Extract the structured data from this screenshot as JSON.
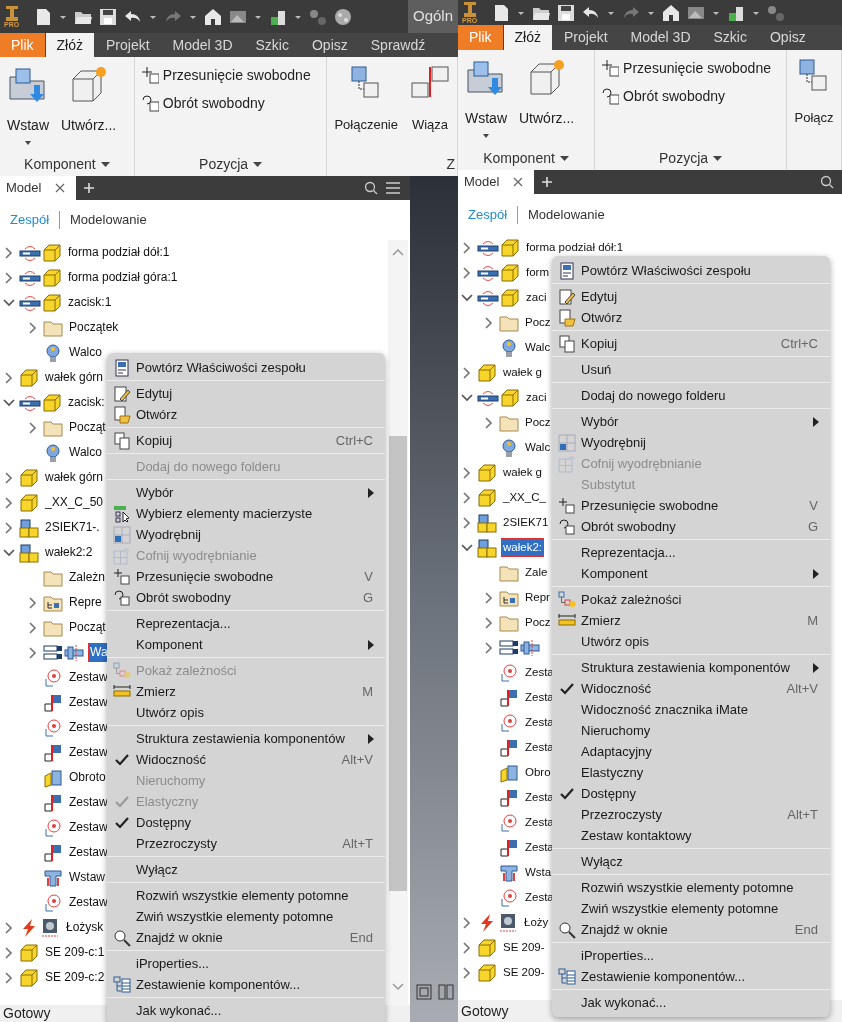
{
  "panels": [
    {
      "toolbar": {
        "edition": "PRO",
        "workspace": "Ogóln"
      },
      "tabs": [
        {
          "label": "Plik",
          "kind": "file",
          "selected": false
        },
        {
          "label": "Złóż",
          "kind": "tab",
          "selected": true
        },
        {
          "label": "Projekt",
          "kind": "tab",
          "selected": false
        },
        {
          "label": "Model 3D",
          "kind": "tab",
          "selected": false
        },
        {
          "label": "Szkic",
          "kind": "tab",
          "selected": false
        },
        {
          "label": "Opisz",
          "kind": "tab",
          "selected": false
        },
        {
          "label": "Sprawdź",
          "kind": "tab",
          "selected": false
        }
      ],
      "ribbon": [
        {
          "kind": "large",
          "title": "Komponent",
          "title_dropdown": true,
          "buttons": [
            {
              "label": "Wstaw",
              "dropdown": true
            },
            {
              "label": "Utwórz...",
              "dropdown": false
            }
          ]
        },
        {
          "kind": "small",
          "title": "Pozycja",
          "title_dropdown": true,
          "buttons": [
            {
              "label": "Przesunięcie swobodne"
            },
            {
              "label": "Obrót swobodny"
            }
          ]
        },
        {
          "kind": "large",
          "title": "Z",
          "title_dropdown": false,
          "buttons": [
            {
              "label": "Połączenie",
              "dropdown": false
            },
            {
              "label": "Wiąza",
              "dropdown": false
            }
          ]
        }
      ],
      "browser": {
        "tab": "Model",
        "subtabs": [
          {
            "label": "Zespół",
            "selected": true
          },
          {
            "label": "Modelowanie",
            "selected": false
          }
        ],
        "tree": [
          {
            "label": "forma podział dół:1",
            "kind": "linkedpart",
            "expanded": false,
            "selected": false
          },
          {
            "label": "forma podział góra:1",
            "kind": "linkedpart",
            "expanded": false,
            "selected": false
          },
          {
            "label": "zacisk:1",
            "kind": "linkedpart",
            "expanded": true,
            "selected": false,
            "children": [
              {
                "label": "Początek",
                "kind": "folder",
                "expanded": false,
                "selected": false
              },
              {
                "label": "Walco",
                "kind": "joint",
                "selected": false
              }
            ]
          },
          {
            "label": "wałek górn",
            "kind": "part",
            "expanded": false,
            "selected": false
          },
          {
            "label": "zacisk:",
            "kind": "linkedpart",
            "expanded": true,
            "selected": false,
            "children": [
              {
                "label": "Począt",
                "kind": "folder",
                "expanded": false,
                "selected": false
              },
              {
                "label": "Walco",
                "kind": "joint",
                "selected": false
              }
            ]
          },
          {
            "label": "wałek górn",
            "kind": "part",
            "expanded": false,
            "selected": false
          },
          {
            "label": "_XX_C_50",
            "kind": "part",
            "expanded": false,
            "selected": false
          },
          {
            "label": "2SIEK71-.",
            "kind": "assembly",
            "expanded": false,
            "selected": false
          },
          {
            "label": "wałek2:2",
            "kind": "assembly",
            "expanded": true,
            "selected": false,
            "children": [
              {
                "label": "Zależn",
                "kind": "folder",
                "selected": false
              },
              {
                "label": "Repre",
                "kind": "views",
                "expanded": false,
                "selected": false
              },
              {
                "label": "Począt",
                "kind": "folder",
                "expanded": false,
                "selected": false
              },
              {
                "label": "Wa",
                "kind": "shaft",
                "expanded": false,
                "selected": true
              },
              {
                "label": "Zestaw",
                "kind": "target",
                "selected": false
              },
              {
                "label": "Zestaw",
                "kind": "flush",
                "selected": false
              },
              {
                "label": "Zestaw",
                "kind": "target",
                "selected": false
              },
              {
                "label": "Zestaw",
                "kind": "flush",
                "selected": false
              },
              {
                "label": "Obroto",
                "kind": "hinge",
                "selected": false
              },
              {
                "label": "Zestaw",
                "kind": "flush",
                "selected": false
              },
              {
                "label": "Zestaw",
                "kind": "target",
                "selected": false
              },
              {
                "label": "Zestaw",
                "kind": "flush",
                "selected": false
              },
              {
                "label": "Wstaw",
                "kind": "insert",
                "selected": false
              },
              {
                "label": "Zestaw",
                "kind": "target",
                "selected": false
              }
            ]
          },
          {
            "label": "Łożysk",
            "kind": "bearing",
            "expanded": false,
            "selected": false
          },
          {
            "label": "SE 209-c:1",
            "kind": "part",
            "expanded": false,
            "selected": false
          },
          {
            "label": "SE 209-c:2",
            "kind": "part",
            "expanded": false,
            "selected": false
          }
        ]
      },
      "context_menu": [
        {
          "kind": "item",
          "label": "Powtórz Właściwości zespołu",
          "disabled": false,
          "checked": false
        },
        {
          "kind": "separator"
        },
        {
          "kind": "item",
          "label": "Edytuj",
          "disabled": false,
          "checked": false
        },
        {
          "kind": "item",
          "label": "Otwórz",
          "disabled": false,
          "checked": false
        },
        {
          "kind": "separator"
        },
        {
          "kind": "item",
          "label": "Kopiuj",
          "shortcut": "Ctrl+C",
          "disabled": false,
          "checked": false
        },
        {
          "kind": "separator"
        },
        {
          "kind": "item",
          "label": "Dodaj do nowego folderu",
          "disabled": true,
          "checked": false
        },
        {
          "kind": "separator"
        },
        {
          "kind": "submenu",
          "label": "Wybór",
          "disabled": false,
          "checked": false
        },
        {
          "kind": "item",
          "label": "Wybierz elementy macierzyste",
          "disabled": false,
          "checked": false
        },
        {
          "kind": "item",
          "label": "Wyodrębnij",
          "disabled": false,
          "checked": false
        },
        {
          "kind": "item",
          "label": "Cofnij wyodrębnianie",
          "disabled": true,
          "checked": false
        },
        {
          "kind": "item",
          "label": "Przesunięcie swobodne",
          "shortcut": "V",
          "disabled": false,
          "checked": false
        },
        {
          "kind": "item",
          "label": "Obrót swobodny",
          "shortcut": "G",
          "disabled": false,
          "checked": false
        },
        {
          "kind": "separator"
        },
        {
          "kind": "item",
          "label": "Reprezentacja...",
          "disabled": false,
          "checked": false
        },
        {
          "kind": "submenu",
          "label": "Komponent",
          "disabled": false,
          "checked": false
        },
        {
          "kind": "separator"
        },
        {
          "kind": "item",
          "label": "Pokaż zależności",
          "disabled": true,
          "checked": false
        },
        {
          "kind": "item",
          "label": "Zmierz",
          "shortcut": "M",
          "disabled": false,
          "checked": false
        },
        {
          "kind": "item",
          "label": "Utwórz opis",
          "disabled": false,
          "checked": false
        },
        {
          "kind": "separator"
        },
        {
          "kind": "submenu",
          "label": "Struktura zestawienia komponentów",
          "disabled": false,
          "checked": false
        },
        {
          "kind": "item",
          "label": "Widoczność",
          "shortcut": "Alt+V",
          "disabled": false,
          "checked": true
        },
        {
          "kind": "item",
          "label": "Nieruchomy",
          "disabled": true,
          "checked": false
        },
        {
          "kind": "item",
          "label": "Elastyczny",
          "disabled": true,
          "checked": true
        },
        {
          "kind": "item",
          "label": "Dostępny",
          "disabled": false,
          "checked": true
        },
        {
          "kind": "item",
          "label": "Przezroczysty",
          "shortcut": "Alt+T",
          "disabled": false,
          "checked": false
        },
        {
          "kind": "separator"
        },
        {
          "kind": "item",
          "label": "Wyłącz",
          "disabled": false,
          "checked": false
        },
        {
          "kind": "separator"
        },
        {
          "kind": "item",
          "label": "Rozwiń wszystkie elementy potomne",
          "disabled": false,
          "checked": false
        },
        {
          "kind": "item",
          "label": "Zwiń wszystkie elementy potomne",
          "disabled": false,
          "checked": false
        },
        {
          "kind": "item",
          "label": "Znajdź w oknie",
          "shortcut": "End",
          "disabled": false,
          "checked": false
        },
        {
          "kind": "separator"
        },
        {
          "kind": "item",
          "label": "iProperties...",
          "disabled": false,
          "checked": false
        },
        {
          "kind": "item",
          "label": "Zestawienie komponentów...",
          "disabled": false,
          "checked": false
        },
        {
          "kind": "separator"
        },
        {
          "kind": "item",
          "label": "Jak wykonać...",
          "disabled": false,
          "checked": false
        }
      ],
      "status_bar": "Gotowy"
    },
    {
      "toolbar": {
        "edition": "PRO"
      },
      "tabs": [
        {
          "label": "Plik",
          "kind": "file",
          "selected": false
        },
        {
          "label": "Złóż",
          "kind": "tab",
          "selected": true
        },
        {
          "label": "Projekt",
          "kind": "tab",
          "selected": false
        },
        {
          "label": "Model 3D",
          "kind": "tab",
          "selected": false
        },
        {
          "label": "Szkic",
          "kind": "tab",
          "selected": false
        },
        {
          "label": "Opisz",
          "kind": "tab",
          "selected": false
        }
      ],
      "ribbon": [
        {
          "kind": "large",
          "title": "Komponent",
          "title_dropdown": true,
          "buttons": [
            {
              "label": "Wstaw",
              "dropdown": true
            },
            {
              "label": "Utwórz...",
              "dropdown": false
            }
          ]
        },
        {
          "kind": "small",
          "title": "Pozycja",
          "title_dropdown": true,
          "buttons": [
            {
              "label": "Przesunięcie swobodne"
            },
            {
              "label": "Obrót swobodny"
            }
          ]
        },
        {
          "kind": "large",
          "buttons": [
            {
              "label": "Połącz",
              "dropdown": false
            }
          ]
        }
      ],
      "browser": {
        "tab": "Model",
        "subtabs": [
          {
            "label": "Zespół",
            "selected": true
          },
          {
            "label": "Modelowanie",
            "selected": false
          }
        ],
        "tree": [
          {
            "label": "forma podział dół:1",
            "kind": "linkedpart",
            "expanded": false,
            "selected": false
          },
          {
            "label": "form",
            "kind": "linkedpart",
            "expanded": false,
            "selected": false
          },
          {
            "label": "zaci",
            "kind": "linkedpart",
            "expanded": true,
            "selected": false,
            "children": [
              {
                "label": "Pocz",
                "kind": "folder",
                "expanded": false,
                "selected": false
              },
              {
                "label": "Walc",
                "kind": "joint",
                "selected": false
              }
            ]
          },
          {
            "label": "wałek g",
            "kind": "part",
            "expanded": false,
            "selected": false
          },
          {
            "label": "zaci",
            "kind": "linkedpart",
            "expanded": true,
            "selected": false,
            "children": [
              {
                "label": "Pocz",
                "kind": "folder",
                "expanded": false,
                "selected": false
              },
              {
                "label": "Walc",
                "kind": "joint",
                "selected": false
              }
            ]
          },
          {
            "label": "wałek g",
            "kind": "part",
            "expanded": false,
            "selected": false
          },
          {
            "label": "_XX_C_",
            "kind": "part",
            "expanded": false,
            "selected": false
          },
          {
            "label": "2SIEK71",
            "kind": "assembly",
            "expanded": false,
            "selected": false
          },
          {
            "label": "wałek2:",
            "kind": "assembly",
            "expanded": true,
            "selected": true,
            "children": [
              {
                "label": "Zale",
                "kind": "folder",
                "selected": false
              },
              {
                "label": "Repr",
                "kind": "views",
                "expanded": false,
                "selected": false
              },
              {
                "label": "Pocz",
                "kind": "folder",
                "expanded": false,
                "selected": false
              },
              {
                "kind": "shaft",
                "expanded": false,
                "selected": false
              },
              {
                "label": "Zesta",
                "kind": "target",
                "selected": false
              },
              {
                "label": "Zesta",
                "kind": "flush",
                "selected": false
              },
              {
                "label": "Zesta",
                "kind": "target",
                "selected": false
              },
              {
                "label": "Zesta",
                "kind": "flush",
                "selected": false
              },
              {
                "label": "Obro",
                "kind": "hinge",
                "selected": false
              },
              {
                "label": "Zesta",
                "kind": "flush",
                "selected": false
              },
              {
                "label": "Zesta",
                "kind": "target",
                "selected": false
              },
              {
                "label": "Zesta",
                "kind": "flush",
                "selected": false
              },
              {
                "label": "Wsta",
                "kind": "insert",
                "selected": false
              },
              {
                "label": "Zesta",
                "kind": "target",
                "selected": false
              }
            ]
          },
          {
            "label": "Łoży",
            "kind": "bearing",
            "expanded": false,
            "selected": false
          },
          {
            "label": "SE 209-",
            "kind": "part",
            "expanded": false,
            "selected": false
          },
          {
            "label": "SE 209-",
            "kind": "part",
            "expanded": false,
            "selected": false
          }
        ]
      },
      "context_menu": [
        {
          "kind": "item",
          "label": "Powtórz Właściwości zespołu",
          "disabled": false,
          "checked": false
        },
        {
          "kind": "separator"
        },
        {
          "kind": "item",
          "label": "Edytuj",
          "disabled": false,
          "checked": false
        },
        {
          "kind": "item",
          "label": "Otwórz",
          "disabled": false,
          "checked": false
        },
        {
          "kind": "separator"
        },
        {
          "kind": "item",
          "label": "Kopiuj",
          "shortcut": "Ctrl+C",
          "disabled": false,
          "checked": false
        },
        {
          "kind": "separator"
        },
        {
          "kind": "item",
          "label": "Usuń",
          "disabled": false,
          "checked": false
        },
        {
          "kind": "separator"
        },
        {
          "kind": "item",
          "label": "Dodaj do nowego folderu",
          "disabled": false,
          "checked": false
        },
        {
          "kind": "separator"
        },
        {
          "kind": "submenu",
          "label": "Wybór",
          "disabled": false,
          "checked": false
        },
        {
          "kind": "item",
          "label": "Wyodrębnij",
          "disabled": false,
          "checked": false
        },
        {
          "kind": "item",
          "label": "Cofnij wyodrębnianie",
          "disabled": true,
          "checked": false
        },
        {
          "kind": "item",
          "label": "Substytut",
          "disabled": true,
          "checked": false
        },
        {
          "kind": "item",
          "label": "Przesunięcie swobodne",
          "shortcut": "V",
          "disabled": false,
          "checked": false
        },
        {
          "kind": "item",
          "label": "Obrót swobodny",
          "shortcut": "G",
          "disabled": false,
          "checked": false
        },
        {
          "kind": "separator"
        },
        {
          "kind": "item",
          "label": "Reprezentacja...",
          "disabled": false,
          "checked": false
        },
        {
          "kind": "submenu",
          "label": "Komponent",
          "disabled": false,
          "checked": false
        },
        {
          "kind": "separator"
        },
        {
          "kind": "item",
          "label": "Pokaż zależności",
          "disabled": false,
          "checked": false
        },
        {
          "kind": "item",
          "label": "Zmierz",
          "shortcut": "M",
          "disabled": false,
          "checked": false
        },
        {
          "kind": "item",
          "label": "Utwórz opis",
          "disabled": false,
          "checked": false
        },
        {
          "kind": "separator"
        },
        {
          "kind": "submenu",
          "label": "Struktura zestawienia komponentów",
          "disabled": false,
          "checked": false
        },
        {
          "kind": "item",
          "label": "Widoczność",
          "shortcut": "Alt+V",
          "disabled": false,
          "checked": true
        },
        {
          "kind": "item",
          "label": "Widoczność znacznika iMate",
          "disabled": false,
          "checked": false
        },
        {
          "kind": "item",
          "label": "Nieruchomy",
          "disabled": false,
          "checked": false
        },
        {
          "kind": "item",
          "label": "Adaptacyjny",
          "disabled": false,
          "checked": false
        },
        {
          "kind": "item",
          "label": "Elastyczny",
          "disabled": false,
          "checked": false
        },
        {
          "kind": "item",
          "label": "Dostępny",
          "disabled": false,
          "checked": true
        },
        {
          "kind": "item",
          "label": "Przezroczysty",
          "shortcut": "Alt+T",
          "disabled": false,
          "checked": false
        },
        {
          "kind": "item",
          "label": "Zestaw kontaktowy",
          "disabled": false,
          "checked": false
        },
        {
          "kind": "separator"
        },
        {
          "kind": "item",
          "label": "Wyłącz",
          "disabled": false,
          "checked": false
        },
        {
          "kind": "separator"
        },
        {
          "kind": "item",
          "label": "Rozwiń wszystkie elementy potomne",
          "disabled": false,
          "checked": false
        },
        {
          "kind": "item",
          "label": "Zwiń wszystkie elementy potomne",
          "disabled": false,
          "checked": false
        },
        {
          "kind": "item",
          "label": "Znajdź w oknie",
          "shortcut": "End",
          "disabled": false,
          "checked": false
        },
        {
          "kind": "separator"
        },
        {
          "kind": "item",
          "label": "iProperties...",
          "disabled": false,
          "checked": false
        },
        {
          "kind": "item",
          "label": "Zestawienie komponentów...",
          "disabled": false,
          "checked": false
        },
        {
          "kind": "separator"
        },
        {
          "kind": "item",
          "label": "Jak wykonać...",
          "disabled": false,
          "checked": false
        }
      ],
      "status_bar": "Gotowy"
    }
  ]
}
